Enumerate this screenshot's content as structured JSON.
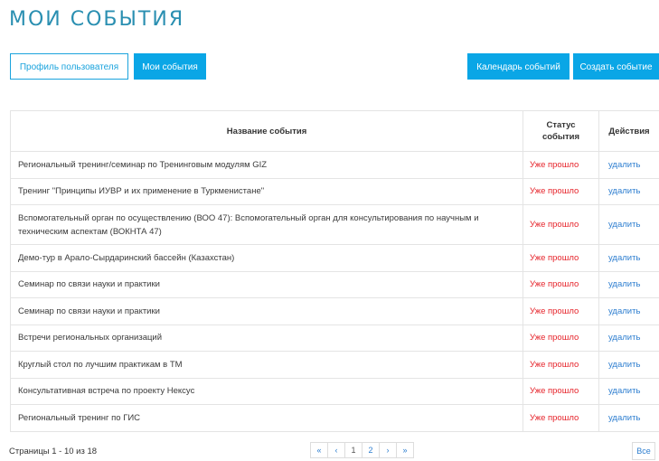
{
  "page": {
    "title": "МОИ СОБЫТИЯ"
  },
  "nav": {
    "profile_label": "Профиль пользователя",
    "my_events_label": "Мои события",
    "calendar_label": "Календарь событий",
    "create_label": "Создать событие"
  },
  "table": {
    "headers": {
      "name": "Название события",
      "status_line1": "Статус",
      "status_line2": "события",
      "actions": "Действия"
    },
    "rows": [
      {
        "name": "Региональный тренинг/семинар по Тренинговым модулям GIZ",
        "status": "Уже прошло",
        "action": "удалить"
      },
      {
        "name": "Тренинг \"Принципы ИУВР и их применение в Туркменистане\"",
        "status": "Уже прошло",
        "action": "удалить"
      },
      {
        "name": "Вспомогательный орган по осуществлению (ВОО 47): Вспомогательный орган для консультирования по научным и техническим аспектам (ВОКНТА 47)",
        "status": "Уже прошло",
        "action": "удалить"
      },
      {
        "name": "Демо-тур в Арало-Сырдаринский бассейн (Казахстан)",
        "status": "Уже прошло",
        "action": "удалить"
      },
      {
        "name": "Семинар по связи науки и практики",
        "status": "Уже прошло",
        "action": "удалить"
      },
      {
        "name": "Семинар по связи науки и практики",
        "status": "Уже прошло",
        "action": "удалить"
      },
      {
        "name": "Встречи региональных организаций",
        "status": "Уже прошло",
        "action": "удалить"
      },
      {
        "name": "Круглый стол по лучшим практикам в ТМ",
        "status": "Уже прошло",
        "action": "удалить"
      },
      {
        "name": "Консультативная встреча по проекту Нексус",
        "status": "Уже прошло",
        "action": "удалить"
      },
      {
        "name": "Региональный тренинг по ГИС",
        "status": "Уже прошло",
        "action": "удалить"
      }
    ]
  },
  "pagination": {
    "info": "Страницы 1 - 10 из 18",
    "first": "«",
    "prev": "‹",
    "page1": "1",
    "page2": "2",
    "next": "›",
    "last": "»",
    "all": "Все"
  },
  "colors": {
    "title": "#2a8fb1",
    "accent": "#0aa6e6",
    "status": "#e6242b",
    "link": "#2f7fd0"
  }
}
